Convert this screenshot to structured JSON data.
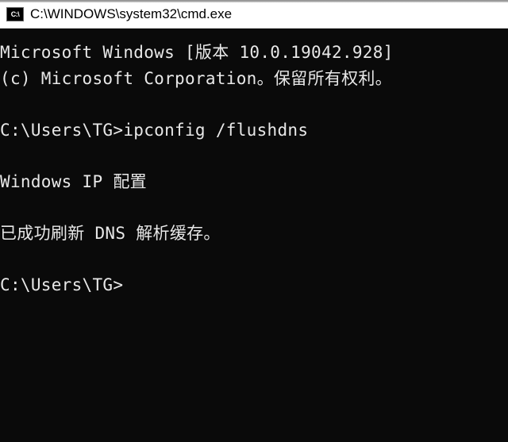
{
  "window": {
    "icon_text": "C:\\",
    "title": "C:\\WINDOWS\\system32\\cmd.exe"
  },
  "terminal": {
    "line_version": "Microsoft Windows [版本 10.0.19042.928]",
    "line_copyright": "(c) Microsoft Corporation。保留所有权利。",
    "prompt1_path": "C:\\Users\\TG>",
    "prompt1_cmd": "ipconfig /flushdns",
    "line_ipconfig_header": "Windows IP 配置",
    "line_success": "已成功刷新 DNS 解析缓存。",
    "prompt2_path": "C:\\Users\\TG>"
  }
}
